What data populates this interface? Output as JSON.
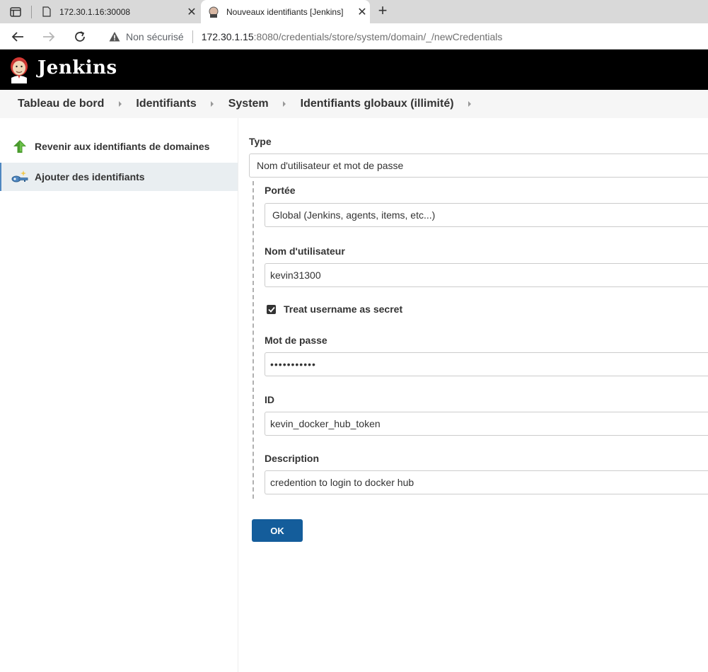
{
  "browser": {
    "tabs": [
      {
        "title": "172.30.1.16:30008"
      },
      {
        "title": "Nouveaux identifiants [Jenkins]"
      }
    ],
    "security_label": "Non sécurisé",
    "url_host": "172.30.1.15",
    "url_path": ":8080/credentials/store/system/domain/_/newCredentials"
  },
  "header": {
    "app_name": "Jenkins"
  },
  "breadcrumbs": [
    {
      "label": "Tableau de bord"
    },
    {
      "label": "Identifiants"
    },
    {
      "label": "System"
    },
    {
      "label": "Identifiants globaux (illimité)"
    }
  ],
  "sidebar": {
    "items": [
      {
        "label": "Revenir aux identifiants de domaines",
        "icon": "up-arrow-icon"
      },
      {
        "label": "Ajouter des identifiants",
        "icon": "key-icon"
      }
    ]
  },
  "form": {
    "type_label": "Type",
    "type_value": "Nom d'utilisateur et mot de passe",
    "scope_label": "Portée",
    "scope_value": "Global (Jenkins, agents, items, etc...)",
    "username_label": "Nom d'utilisateur",
    "username_value": "kevin31300",
    "secret_label": "Treat username as secret",
    "secret_checked": true,
    "password_label": "Mot de passe",
    "password_value": "•••••••••••",
    "id_label": "ID",
    "id_value": "kevin_docker_hub_token",
    "description_label": "Description",
    "description_value": "credention to login to docker hub",
    "ok_label": "OK"
  },
  "colors": {
    "header_bg": "#000000",
    "ok_button": "#145d9b",
    "selected_item_bg": "#e9eef1"
  }
}
